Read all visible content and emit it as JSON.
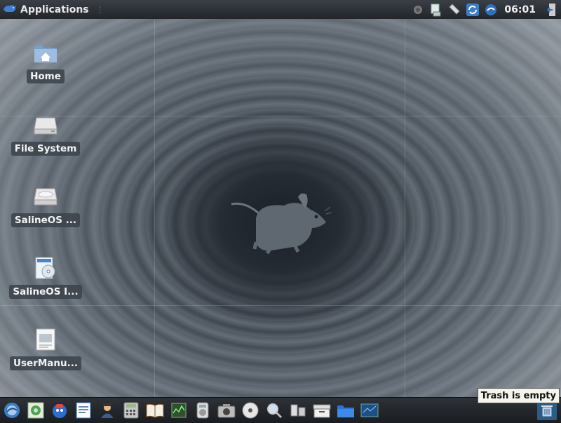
{
  "top_panel": {
    "applications_label": "Applications",
    "clock": "06:01",
    "tray_icons": [
      "volume-icon",
      "network-icon",
      "clipboard-icon",
      "update-icon",
      "browser-icon",
      "logout-icon"
    ]
  },
  "desktop": {
    "icons": [
      {
        "label": "Home",
        "icon": "home-folder-icon"
      },
      {
        "label": "File System",
        "icon": "drive-icon"
      },
      {
        "label": "SalineOS ...",
        "icon": "optical-drive-icon"
      },
      {
        "label": "SalineOS I...",
        "icon": "installer-icon"
      },
      {
        "label": "UserManu...",
        "icon": "document-icon"
      }
    ]
  },
  "bottom_panel": {
    "launchers": [
      "web-browser-icon",
      "image-viewer-icon",
      "chat-icon",
      "text-editor-icon",
      "user-icon",
      "calculator-icon",
      "dictionary-icon",
      "system-monitor-icon",
      "audio-player-icon",
      "camera-icon",
      "cd-burner-icon",
      "search-icon",
      "network-manager-icon",
      "archive-icon",
      "file-manager-icon",
      "screenshot-icon"
    ],
    "trash_icon": "trash-icon"
  },
  "tooltip": {
    "text": "Trash is empty"
  },
  "colors": {
    "panel": "#22262b",
    "label_bg": "#3c424a",
    "accent": "#2a6fb5"
  }
}
